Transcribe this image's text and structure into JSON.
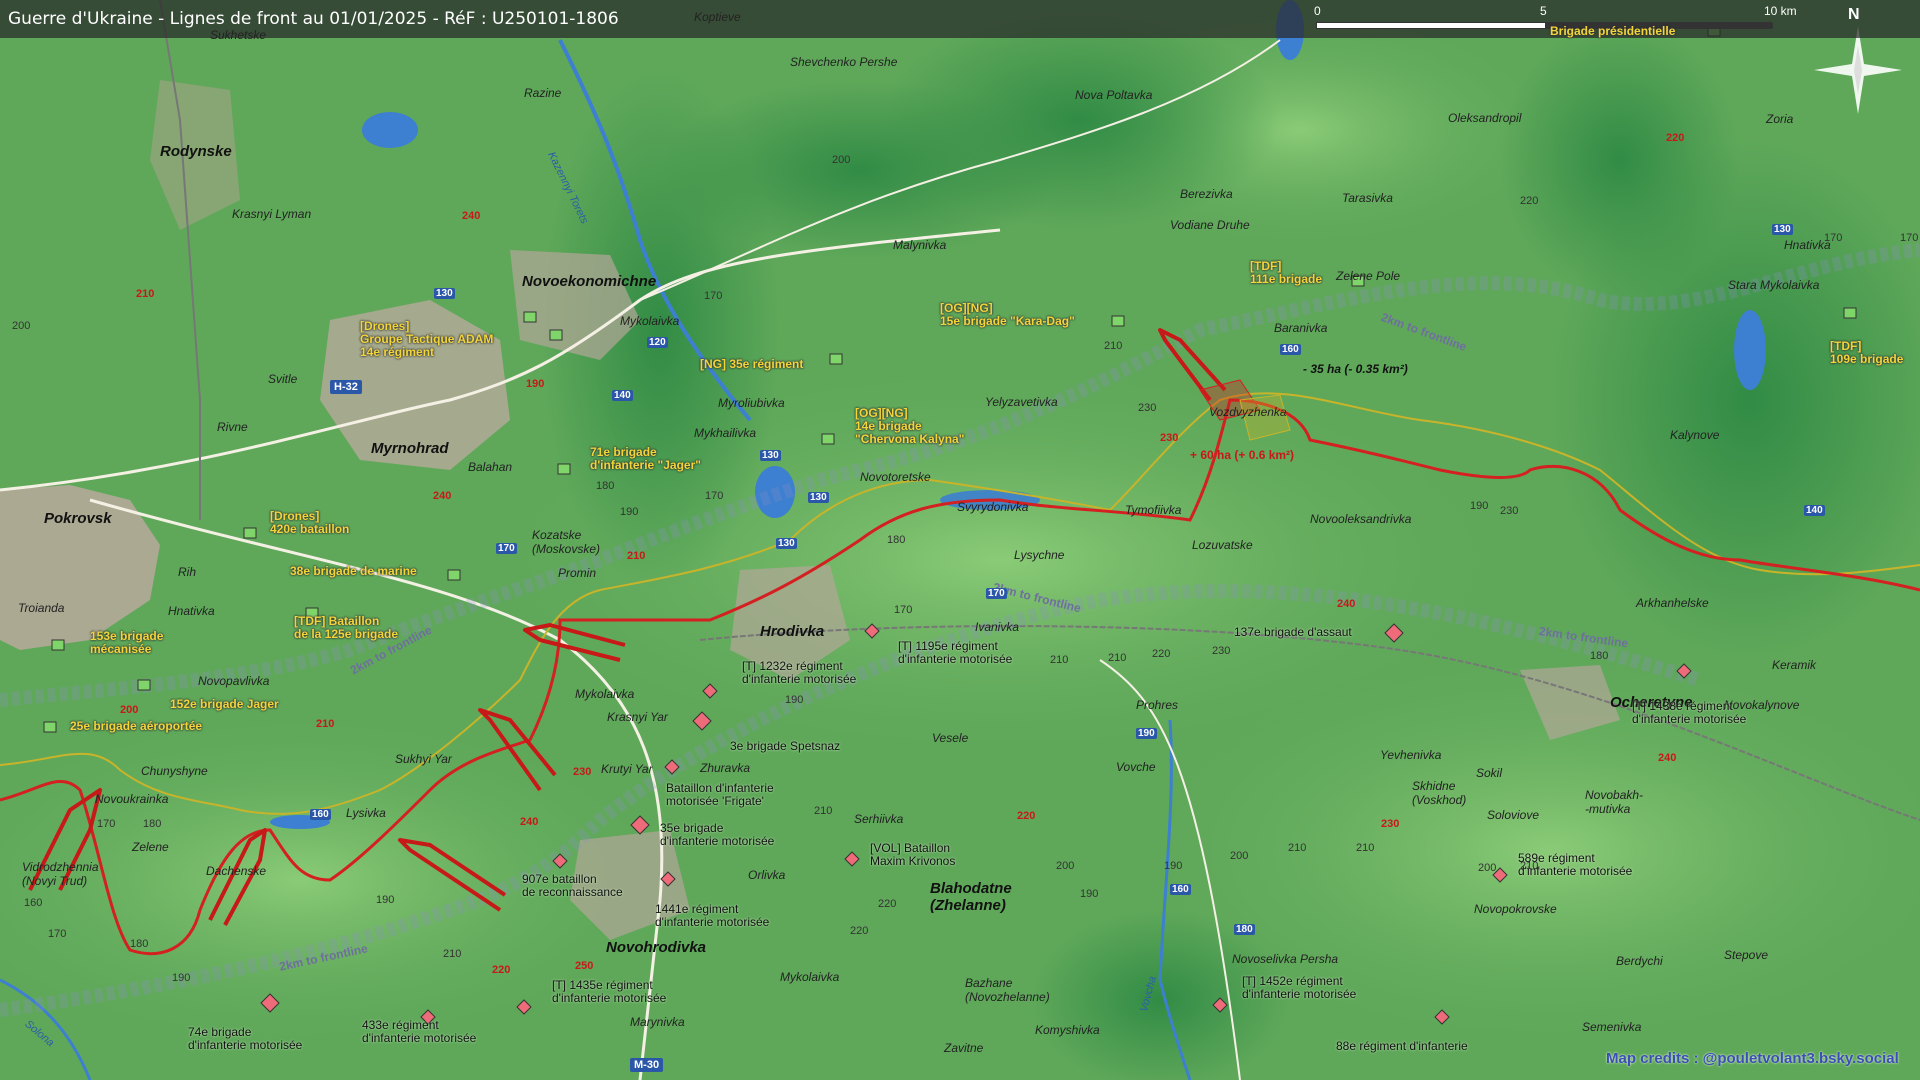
{
  "title": "Guerre d'Ukraine - Lignes de front au 01/01/2025 - RéF : U250101-1806",
  "scale": {
    "labels": [
      "0",
      "5",
      "10 km"
    ]
  },
  "north": "N",
  "credits": "Map credits : @pouletvolant3.bsky.social",
  "colors": {
    "front": "#d42020",
    "old_front": "#c8b42a",
    "water": "#3d7fd0",
    "background": "#5fa85a",
    "dark": "#2f8a44"
  },
  "cities": {
    "pokrovsk": "Pokrovsk",
    "myrnohrad": "Myrnohrad",
    "rodynske": "Rodynske",
    "novoekonomichne": "Novoekonomichne",
    "hrodivka": "Hrodivka",
    "novohrodivka": "Novohrodivka",
    "ocheretyne": "Ocheretyne",
    "blahodatne": "Blahodatne\n(Zhelanne)"
  },
  "towns": {
    "koptieve": "Koptieve",
    "sukhetske": "Sukhetske",
    "razine": "Razine",
    "shevchenko": "Shevchenko Pershe",
    "nova_poltavka": "Nova Poltavka",
    "oleksandropil": "Oleksandropil",
    "zoria": "Zoria",
    "krasnyi_lyman": "Krasnyi Lyman",
    "berezivka": "Berezivka",
    "tarasivka": "Tarasivka",
    "vodiane": "Vodiane Druhe",
    "malynivka": "Malynivka",
    "hnativka_n": "Hnativka",
    "zelene_pole": "Zelene Pole",
    "stara_mykolaivka": "Stara Mykolaivka",
    "mykolaivka": "Mykolaivka",
    "baranivka": "Baranivka",
    "svitle": "Svitle",
    "myroliubivka": "Myroliubivka",
    "yelyzavetivka": "Yelyzavetivka",
    "vozdvyzhenka": "Vozdvyzhenka",
    "rivne": "Rivne",
    "mykhailivka": "Mykhailivka",
    "kalynove": "Kalynove",
    "balahan": "Balahan",
    "novotoretske": "Novotoretske",
    "svyrydonivka": "Svyrydonivka",
    "tymofiivka": "Tymofiivka",
    "lozuvatske": "Lozuvatske",
    "novooleksandrivka": "Novooleksandrivka",
    "kozatske": "Kozatske\n(Moskovske)",
    "lysychne": "Lysychne",
    "rih": "Rih",
    "promin": "Promin",
    "arkhanhelske": "Arkhanhelske",
    "troianda": "Troianda",
    "hnativka": "Hnativka",
    "ivanivka": "Ivanivka",
    "keramik": "Keramik",
    "novopavlivka": "Novopavlivka",
    "mykolaivka_s": "Mykolaivka",
    "krasnyi_yar": "Krasnyi Yar",
    "novokalynove": "Novokalynove",
    "prohres": "Prohres",
    "veselе": "Veselе",
    "chunyshyne": "Chunyshyne",
    "sukhyi_yar": "Sukhyi Yar",
    "krutyi_yar": "Krutyi Yar",
    "zhuravka": "Zhuravka",
    "yevhenivka": "Yevhenivka",
    "sokil": "Sokil",
    "novoukrainka": "Novoukrainka",
    "vovche": "Vovche",
    "skhidne": "Skhidne\n(Voskhod)",
    "novobakh": "Novobakh-\n-mutivka",
    "lysivka": "Lysivka",
    "zelene": "Zelene",
    "serhiivka": "Serhiivka",
    "soloviove": "Soloviove",
    "vidrodzhennia": "Vidrodzhennia\n(Novyi Trud)",
    "dachenske": "Dachenske",
    "orlivka": "Orlivka",
    "novopokrovske": "Novopokrovske",
    "berdychi": "Berdychi",
    "stepove": "Stepove",
    "novoselivka": "Novoselivka Persha",
    "mykolaivka_ss": "Mykolaivka",
    "bazhane": "Bazhane\n(Novozhelanne)",
    "marynivka": "Marynivka",
    "komyshivka": "Komyshivka",
    "semenivka": "Semenivka",
    "zavitne": "Zavitne"
  },
  "rivers": {
    "kazennyi": "Kazennyi Torets",
    "vovcha": "Vovcha",
    "solona": "Solona"
  },
  "roads": {
    "h32": "H-32",
    "m30": "M-30",
    "r130a": "130",
    "r120": "120",
    "r140a": "140",
    "r130b": "130",
    "r130c": "130",
    "r130d": "130",
    "r170": "170",
    "r160a": "160",
    "r130e": "130",
    "r140b": "140",
    "r170b": "170",
    "r190": "190",
    "r160b": "160",
    "r180": "180",
    "r160c": "160"
  },
  "altitudes": {
    "a1": "200",
    "a2": "220",
    "a3": "170",
    "a4": "200",
    "a5": "210",
    "a6": "180",
    "a7": "190",
    "a8": "170",
    "a9": "180",
    "a10": "170",
    "a11": "210",
    "a12": "220",
    "a13": "230",
    "a14": "190",
    "a15": "180",
    "a16": "170",
    "a17": "170",
    "a18": "190",
    "a19": "210",
    "a20": "220",
    "a21": "230",
    "a22": "200",
    "a23": "190",
    "a24": "210",
    "a25": "210",
    "a26": "190",
    "a27": "170",
    "a28": "180",
    "a29": "160",
    "a30": "170",
    "a31": "180",
    "a32": "190",
    "a33": "210",
    "a34": "200",
    "a35": "220",
    "a36": "190",
    "a37": "200",
    "a38": "210",
    "a39": "210",
    "a40": "230"
  },
  "altitudes_red": {
    "r1": "210",
    "r2": "240",
    "r3": "190",
    "r4": "240",
    "r5": "210",
    "r6": "220",
    "r7": "230",
    "r8": "240",
    "r9": "200",
    "r10": "210",
    "r11": "230",
    "r12": "240",
    "r13": "220",
    "r14": "230",
    "r15": "240",
    "r16": "250",
    "r17": "220"
  },
  "frontline_labels": {
    "f1": "2km to frontline",
    "f2": "2km to frontline",
    "f3": "2km to frontline",
    "f4": "2km to frontline",
    "f5": "2km to frontline"
  },
  "territory": {
    "loss": "- 35 ha (- 0.35 km²)",
    "gain": "+ 60 ha (+ 0.6 km²)"
  },
  "units_ua": {
    "u1": "[Drones]\nGroupe Tactique ADAM\n14e régiment",
    "u2": "[Drones]\n420e bataillon",
    "u3": "71e brigade\nd'infanterie \"Jager\"",
    "u4": "38e brigade de marine",
    "u5": "[TDF] Bataillon\nde la 125e brigade",
    "u6": "153e brigade\nmécanisée",
    "u7": "152e brigade Jager",
    "u8": "25e brigade aéroportée",
    "u9": "[NG] 35e régiment",
    "u10": "[OG][NG]\n14e brigade\n\"Chervona Kalyna\"",
    "u11": "[OG][NG]\n15e brigade \"Kara-Dag\"",
    "u12": "[TDF]\n111e brigade",
    "u13": "[TDF]\n109e brigade",
    "u14": "Brigade présidentielle"
  },
  "units_ru": {
    "r1": "[T] 1232e régiment\nd'infanterie motorisée",
    "r2": "3e brigade Spetsnaz",
    "r3": "Bataillon d'infanterie\nmotorisée 'Frigate'",
    "r4": "35e brigade\nd'infanterie motorisée",
    "r5": "907e bataillon\nde reconnaissance",
    "r6": "1441e régiment\nd'infanterie motorisée",
    "r7": "[T] 1195e régiment\nd'infanterie motorisée",
    "r8": "[VOL] Bataillon\nMaxim Krivonos",
    "r9": "137e brigade d'assaut",
    "r10": "[T] 1438e régiment\nd'infanterie motorisée",
    "r11": "589e régiment\nd'infanterie motorisée",
    "r12": "[T] 1452e régiment\nd'infanterie motorisée",
    "r13": "88e régiment d'infanterie",
    "r14": "[T] 1435e régiment\nd'infanterie motorisée",
    "r15": "433e régiment\nd'infanterie motorisée",
    "r16": "74e brigade\nd'infanterie motorisée"
  }
}
